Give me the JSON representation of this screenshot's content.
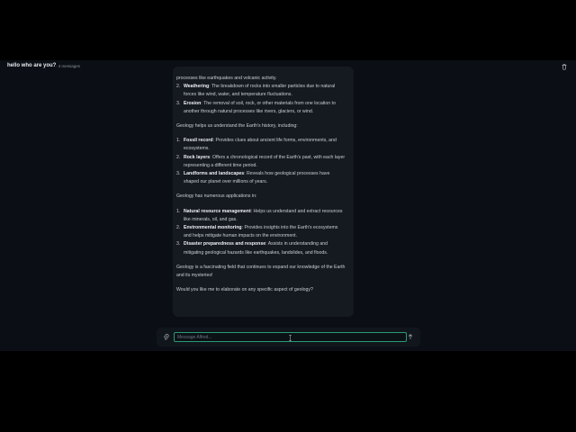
{
  "header": {
    "title": "hello who are you?",
    "message_count": "· 4 messages",
    "delete_icon": "trash-icon"
  },
  "message": {
    "top_line": "processes like earthquakes and volcanic activity.",
    "list1": [
      {
        "num": "2.",
        "term": "Weathering",
        "text": ": The breakdown of rocks into smaller particles due to natural forces like wind, water, and temperature fluctuations."
      },
      {
        "num": "3.",
        "term": "Erosion",
        "text": ": The removal of soil, rock, or other materials from one location to another through natural processes like rivers, glaciers, or wind."
      }
    ],
    "para1": "Geology helps us understand the Earth's history, including:",
    "list2": [
      {
        "num": "1.",
        "term": "Fossil record",
        "text": ": Provides clues about ancient life forms, environments, and ecosystems."
      },
      {
        "num": "2.",
        "term": "Rock layers",
        "text": ": Offers a chronological record of the Earth's past, with each layer representing a different time period."
      },
      {
        "num": "3.",
        "term": "Landforms and landscapes",
        "text": ": Reveals how geological processes have shaped our planet over millions of years."
      }
    ],
    "para2": "Geology has numerous applications in:",
    "list3": [
      {
        "num": "1.",
        "term": "Natural resource management",
        "text": ": Helps us understand and extract resources like minerals, oil, and gas."
      },
      {
        "num": "2.",
        "term": "Environmental monitoring",
        "text": ": Provides insights into the Earth's ecosystems and helps mitigate human impacts on the environment."
      },
      {
        "num": "3.",
        "term": "Disaster preparedness and response",
        "text": ": Assists in understanding and mitigating geological hazards like earthquakes, landslides, and floods."
      }
    ],
    "para3": "Geology is a fascinating field that continues to expand our knowledge of the Earth and its mysteries!",
    "para4": "Would you like me to elaborate on any specific aspect of geology?"
  },
  "composer": {
    "placeholder": "Message Alfred...",
    "value": "",
    "attach_icon": "paperclip-icon",
    "send_icon": "arrow-up-icon"
  },
  "colors": {
    "background": "#0b0f15",
    "bubble": "#151a21",
    "accent": "#2b9a73"
  }
}
